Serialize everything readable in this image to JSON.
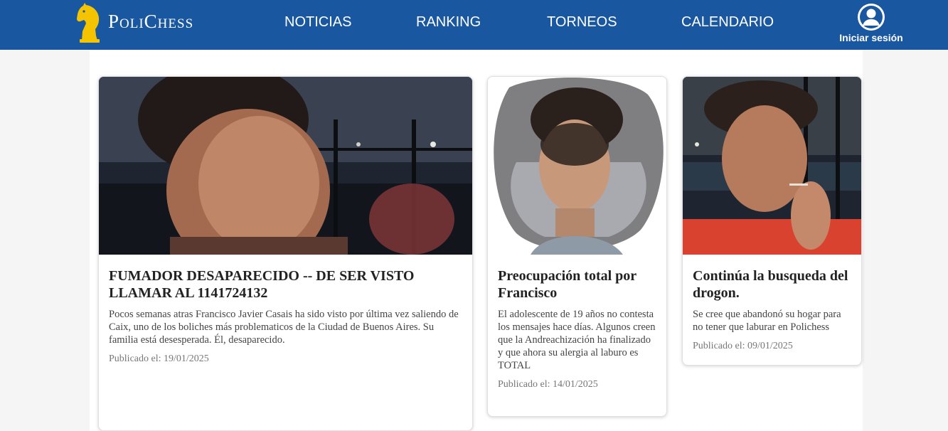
{
  "brand": {
    "name": "PoliChess"
  },
  "nav": {
    "items": [
      {
        "label": "NOTICIAS"
      },
      {
        "label": "RANKING"
      },
      {
        "label": "TORNEOS"
      },
      {
        "label": "CALENDARIO"
      }
    ]
  },
  "user": {
    "login_label": "Iniciar sesión",
    "icon": "user-circle-icon"
  },
  "colors": {
    "header": "#1a57a1",
    "knight": "#f5c400",
    "page_bg": "#f5f5f5"
  },
  "cards": [
    {
      "title": "FUMADOR DESAPARECIDO -- DE SER VISTO LLAMAR AL 1141724132",
      "description": "Pocos semanas atras Francisco Javier Casais ha sido visto por última vez saliendo de Caix, uno de los boliches más problematicos de la Ciudad de Buenos Aires. Su familia está desesperada. Él, desaparecido.",
      "date": "Publicado el: 19/01/2025"
    },
    {
      "title": "Preocupación total por Francisco",
      "description": "El adolescente de 19 años no contesta los mensajes hace días. Algunos creen que la Andreachización ha finalizado y que ahora su alergia al laburo es TOTAL",
      "date": "Publicado el: 14/01/2025"
    },
    {
      "title": "Continúa la busqueda del drogon.",
      "description": "Se cree que abandonó su hogar para no tener que laburar en Polichess",
      "date": "Publicado el: 09/01/2025"
    }
  ]
}
